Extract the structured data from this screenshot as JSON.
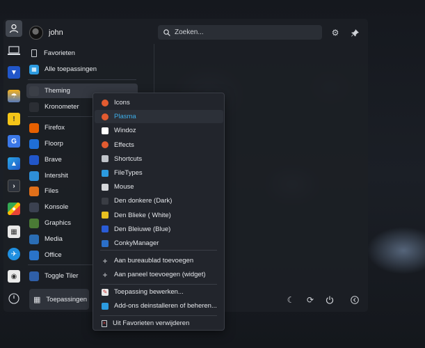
{
  "user": {
    "name": "john"
  },
  "search": {
    "placeholder": "Zoeken..."
  },
  "nav": {
    "favorites": "Favorieten",
    "all_apps": "Alle toepassingen"
  },
  "apps": [
    {
      "label": "Theming",
      "icon": "theming-icon",
      "color": "#3b3f47"
    },
    {
      "label": "Kronometer",
      "icon": "kronometer-icon",
      "color": "#2b2e34"
    },
    {
      "label": "Firefox",
      "icon": "firefox-icon",
      "color": "#e66000"
    },
    {
      "label": "Floorp",
      "icon": "floorp-icon",
      "color": "#1f6fd6"
    },
    {
      "label": "Brave",
      "icon": "brave-icon",
      "color": "#2156c9"
    },
    {
      "label": "Intershit",
      "icon": "intershit-icon",
      "color": "#2e8fd8"
    },
    {
      "label": "Files",
      "icon": "files-icon",
      "color": "#e0701a"
    },
    {
      "label": "Konsole",
      "icon": "konsole-icon",
      "color": "#3b4150"
    },
    {
      "label": "Graphics",
      "icon": "graphics-icon",
      "color": "#4a7a35"
    },
    {
      "label": "Media",
      "icon": "media-icon",
      "color": "#2a6db4"
    },
    {
      "label": "Office",
      "icon": "office-icon",
      "color": "#2a73c9"
    },
    {
      "label": "Toggle Tiler",
      "icon": "tiler-icon",
      "color": "#2f5fa8"
    }
  ],
  "bottom": {
    "apps_button": "Toepassingen"
  },
  "context_menu": {
    "items": [
      {
        "label": "Icons",
        "icon": "icons-icon",
        "color": "#e25b30"
      },
      {
        "label": "Plasma",
        "icon": "plasma-icon",
        "color": "#e25b30"
      },
      {
        "label": "Windoz",
        "icon": "windoz-icon",
        "color": "#ffffff"
      },
      {
        "label": "Effects",
        "icon": "effects-icon",
        "color": "#e25b30"
      },
      {
        "label": "Shortcuts",
        "icon": "shortcuts-icon",
        "color": "#c0c4ca"
      },
      {
        "label": "FileTypes",
        "icon": "filetypes-icon",
        "color": "#2c9be0"
      },
      {
        "label": "Mouse",
        "icon": "mouse-icon",
        "color": "#d5d7db"
      },
      {
        "label": "Den donkere (Dark)",
        "icon": "folder-dark-icon",
        "color": "#3a3d44"
      },
      {
        "label": "Den Blieke ( White)",
        "icon": "folder-yellow-icon",
        "color": "#e8c020"
      },
      {
        "label": "Den Bleiuwe (Blue)",
        "icon": "folder-blue-icon",
        "color": "#2a5cd6"
      },
      {
        "label": "ConkyManager",
        "icon": "conky-icon",
        "color": "#2b6fc8"
      }
    ],
    "add_desktop": "Aan bureaublad toevoegen",
    "add_panel": "Aan paneel toevoegen (widget)",
    "edit_app": "Toepassing bewerken...",
    "uninstall": "Add-ons deinstalleren of beheren...",
    "remove_fav": "Uit Favorieten verwijderen"
  },
  "colors": {
    "accent": "#3daee9",
    "panel": "#1c1f25"
  }
}
